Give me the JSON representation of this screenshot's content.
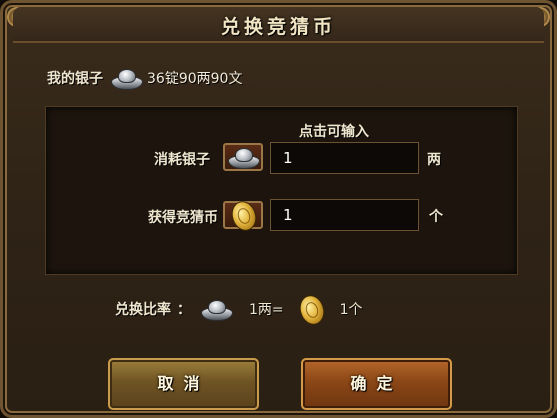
{
  "dialog": {
    "title": "兑换竞猜币"
  },
  "balance": {
    "label": "我的银子",
    "icon": "silver-ingot-icon",
    "value": "36锭90两90文"
  },
  "form": {
    "hint": "点击可输入",
    "spend": {
      "label": "消耗银子",
      "icon": "silver-ingot-icon",
      "value": "1",
      "unit": "两"
    },
    "receive": {
      "label": "获得竞猜币",
      "icon": "gold-coin-icon",
      "value": "1",
      "unit": "个"
    }
  },
  "ratio": {
    "label": "兑换比率",
    "separator": "：",
    "silver_amount": "1两=",
    "coin_amount": "1个"
  },
  "buttons": {
    "cancel": "取消",
    "confirm": "确定"
  },
  "colors": {
    "text": "#efe6cf",
    "cancel_button": "#6f5424",
    "confirm_button": "#8b4716",
    "frame": "#6f5431"
  }
}
